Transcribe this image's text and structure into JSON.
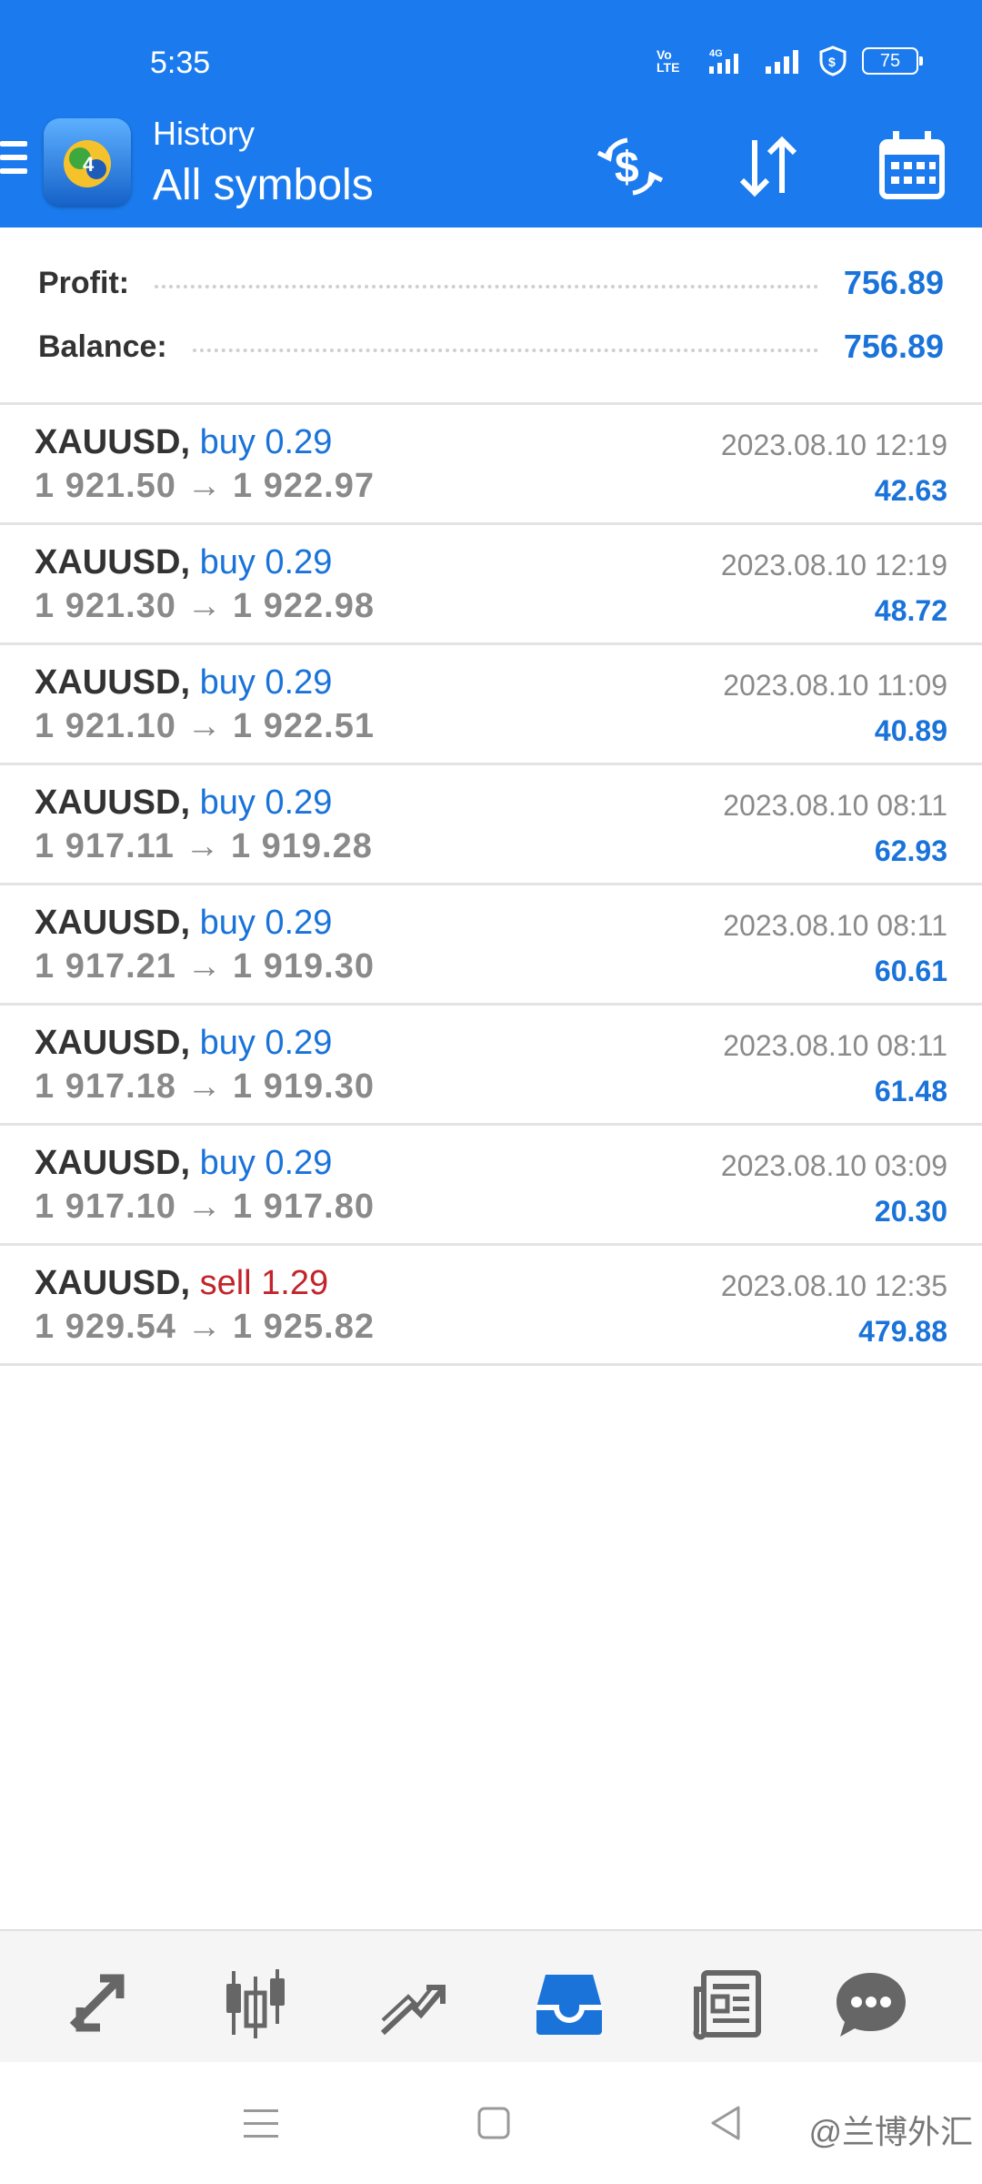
{
  "status_bar": {
    "time": "5:35",
    "volte_label": "Vo LTE",
    "network_label": "4G",
    "battery": "75"
  },
  "header": {
    "section": "History",
    "filter": "All symbols",
    "actions": [
      "currency-exchange",
      "sort",
      "calendar"
    ]
  },
  "summary": {
    "profit_label": "Profit:",
    "profit_value": "756.89",
    "balance_label": "Balance:",
    "balance_value": "756.89"
  },
  "trades": [
    {
      "symbol": "XAUUSD,",
      "side": "buy 0.29",
      "type": "buy",
      "open": "1 921.50",
      "close": "1 922.97",
      "time": "2023.08.10 12:19",
      "profit": "42.63"
    },
    {
      "symbol": "XAUUSD,",
      "side": "buy 0.29",
      "type": "buy",
      "open": "1 921.30",
      "close": "1 922.98",
      "time": "2023.08.10 12:19",
      "profit": "48.72"
    },
    {
      "symbol": "XAUUSD,",
      "side": "buy 0.29",
      "type": "buy",
      "open": "1 921.10",
      "close": "1 922.51",
      "time": "2023.08.10 11:09",
      "profit": "40.89"
    },
    {
      "symbol": "XAUUSD,",
      "side": "buy 0.29",
      "type": "buy",
      "open": "1 917.11",
      "close": "1 919.28",
      "time": "2023.08.10 08:11",
      "profit": "62.93"
    },
    {
      "symbol": "XAUUSD,",
      "side": "buy 0.29",
      "type": "buy",
      "open": "1 917.21",
      "close": "1 919.30",
      "time": "2023.08.10 08:11",
      "profit": "60.61"
    },
    {
      "symbol": "XAUUSD,",
      "side": "buy 0.29",
      "type": "buy",
      "open": "1 917.18",
      "close": "1 919.30",
      "time": "2023.08.10 08:11",
      "profit": "61.48"
    },
    {
      "symbol": "XAUUSD,",
      "side": "buy 0.29",
      "type": "buy",
      "open": "1 917.10",
      "close": "1 917.80",
      "time": "2023.08.10 03:09",
      "profit": "20.30"
    },
    {
      "symbol": "XAUUSD,",
      "side": "sell 1.29",
      "type": "sell",
      "open": "1 929.54",
      "close": "1 925.82",
      "time": "2023.08.10 12:35",
      "profit": "479.88"
    }
  ],
  "arrow": "→",
  "bottom_nav": [
    "quotes",
    "chart",
    "trade",
    "history",
    "news",
    "chat"
  ],
  "watermark": "@兰博外汇",
  "colors": {
    "accent": "#1b7bee",
    "profit": "#1a73d9",
    "sell": "#c3242b",
    "muted": "#8a8a8a"
  }
}
